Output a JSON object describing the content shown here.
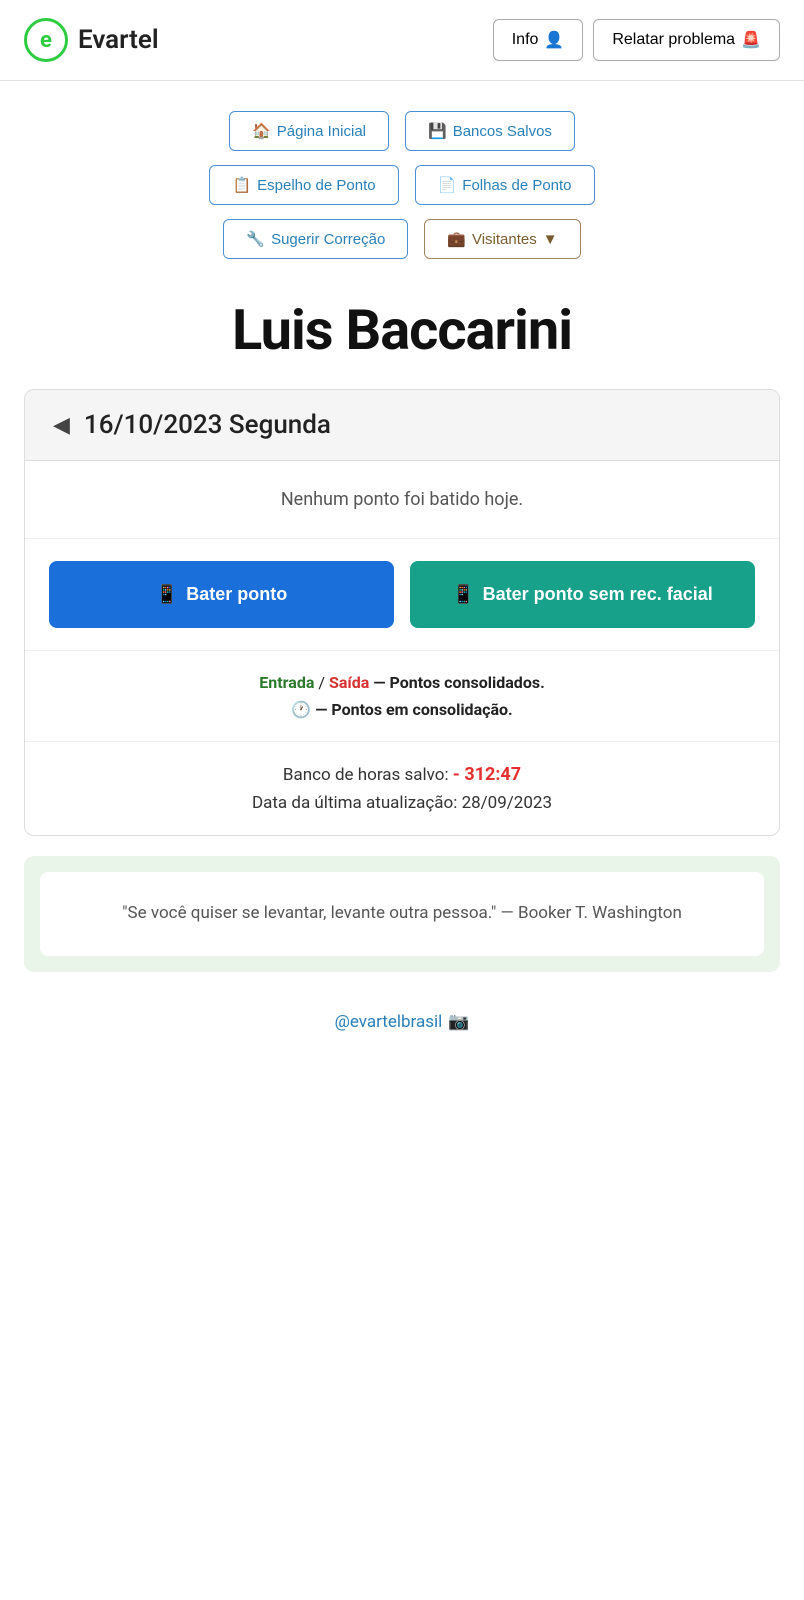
{
  "header": {
    "logo_letter": "e",
    "logo_name": "Evartel",
    "btn_info_label": "Info",
    "btn_info_icon": "👤",
    "btn_report_label": "Relatar problema",
    "btn_report_icon": "🚨"
  },
  "nav": {
    "row1": [
      {
        "id": "pagina-inicial",
        "icon": "🏠",
        "label": "Página Inicial"
      },
      {
        "id": "bancos-salvos",
        "icon": "💾",
        "label": "Bancos Salvos"
      }
    ],
    "row2": [
      {
        "id": "espelho-de-ponto",
        "icon": "📋",
        "label": "Espelho de Ponto"
      },
      {
        "id": "folhas-de-ponto",
        "icon": "📄",
        "label": "Folhas de Ponto"
      }
    ],
    "row3": [
      {
        "id": "sugerir-correcao",
        "icon": "🔧",
        "label": "Sugerir Correção"
      },
      {
        "id": "visitantes",
        "icon": "💼",
        "label": "Visitantes",
        "has_arrow": true
      }
    ]
  },
  "user": {
    "name": "Luis Baccarini"
  },
  "date_card": {
    "arrow": "◀",
    "date": "16/10/2023",
    "day": "Segunda",
    "no_points_message": "Nenhum ponto foi batido hoje.",
    "btn_bater_icon": "📱",
    "btn_bater_label": "Bater ponto",
    "btn_bater_sem_icon": "📱",
    "btn_bater_sem_label": "Bater ponto sem rec. facial",
    "legend_entrada": "Entrada",
    "legend_slash": "/",
    "legend_saida": "Saída",
    "legend_consolidated": "— Pontos consolidados.",
    "legend_clock": "🕐",
    "legend_consolidating": "— Pontos em consolidação.",
    "banco_label": "Banco de horas salvo:",
    "banco_value": "- 312:47",
    "update_label": "Data da última atualização:",
    "update_date": "28/09/2023"
  },
  "quote": {
    "text": "\"Se você quiser se levantar, levante outra pessoa.\"",
    "author": "— Booker T. Washington"
  },
  "footer": {
    "instagram_label": "@evartelbrasil",
    "instagram_icon": "📷"
  }
}
